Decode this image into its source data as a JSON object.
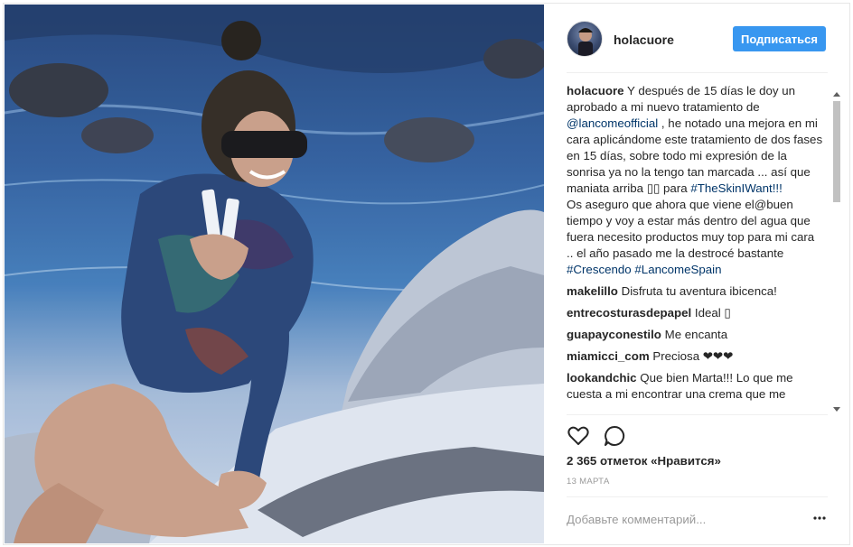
{
  "photo": {
    "alt": ""
  },
  "header": {
    "username": "holacuore",
    "follow_label": "Подписаться"
  },
  "caption": {
    "username": "holacuore",
    "text_1": " Y después de 15 días le doy un aprobado a mi nuevo tratamiento de ",
    "mention": "@lancomeofficial",
    "text_2": " , he notado una mejora en mi cara aplicándome este tratamiento de dos fases en 15 días, sobre todo mi expresión de la sonrisa ya no la tengo tan marcada ... así que maniata arriba ▯▯ para ",
    "hashtag_1": "#TheSkinIWant!!!",
    "text_3": "Os aseguro que ahora que viene el@buen tiempo y voy a estar más dentro del agua que fuera necesito productos muy top para mi cara .. el año pasado me la destrocé bastante ",
    "hashtag_2": "#Crescendo",
    "hashtag_3": "#LancomeSpain"
  },
  "comments": [
    {
      "username": "makelillo",
      "text": "Disfruta tu aventura ibicenca!"
    },
    {
      "username": "entrecosturasdepapel",
      "text": "Ideal ▯"
    },
    {
      "username": "guapayconestilo",
      "text": "Me encanta"
    },
    {
      "username": "miamicci_com",
      "text": "Preciosa ❤❤❤"
    },
    {
      "username": "lookandchic",
      "text": "Que bien Marta!!! Lo que me cuesta a mi encontrar una crema que me"
    }
  ],
  "actions": {
    "like_icon": "heart-icon",
    "comment_icon": "comment-icon"
  },
  "likes_text": "2 365 отметок «Нравится»",
  "date_text": "13 МАРТА",
  "add_comment_placeholder": "Добавьте комментарий...",
  "more_icon": "more-options-icon",
  "colors": {
    "accent": "#3897f0",
    "link": "#003569",
    "text": "#262626",
    "muted": "#999999"
  }
}
